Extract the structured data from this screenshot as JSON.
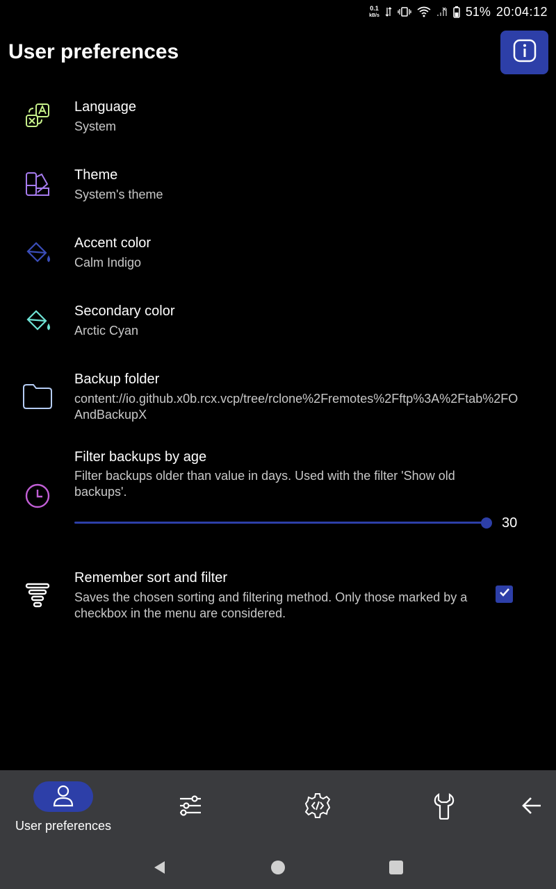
{
  "status_bar": {
    "net_speed_value": "0.1",
    "net_speed_unit": "kB/s",
    "battery_percent": "51%",
    "time": "20:04:12"
  },
  "header": {
    "title": "User preferences",
    "info_icon": "info-icon"
  },
  "preferences": [
    {
      "key": "language",
      "title": "Language",
      "summary": "System",
      "icon": "language-icon",
      "icon_color": "#c6f08a"
    },
    {
      "key": "theme",
      "title": "Theme",
      "summary": "System's theme",
      "icon": "theme-icon",
      "icon_color": "#a77cf0"
    },
    {
      "key": "accent",
      "title": "Accent color",
      "summary": "Calm Indigo",
      "icon": "paint-bucket-icon",
      "icon_color": "#3a4db8"
    },
    {
      "key": "secondary",
      "title": "Secondary color",
      "summary": "Arctic Cyan",
      "icon": "paint-bucket-icon",
      "icon_color": "#6fe3d5"
    },
    {
      "key": "backup",
      "title": "Backup folder",
      "summary": "content://io.github.x0b.rcx.vcp/tree/rclone%2Fremotes%2Fftp%3A%2Ftab%2FOAndBackupX",
      "icon": "folder-icon",
      "icon_color": "#b6cdf5"
    },
    {
      "key": "filter_age",
      "title": "Filter backups by age",
      "summary": "Filter backups older than value in days. Used with the filter 'Show old backups'.",
      "icon": "clock-icon",
      "icon_color": "#c25fd6",
      "value": "30",
      "slider_fraction": 1.0
    },
    {
      "key": "remember_sort",
      "title": "Remember sort and filter",
      "summary": "Saves the chosen sorting and filtering method. Only those marked by a checkbox in the menu are considered.",
      "icon": "filter-icon",
      "icon_color": "#ffffff",
      "checked": true
    }
  ],
  "bottom_nav": {
    "items": [
      {
        "label": "User preferences",
        "icon": "person-icon",
        "selected": true
      },
      {
        "label": "",
        "icon": "sliders-icon"
      },
      {
        "label": "",
        "icon": "gear-code-icon"
      },
      {
        "label": "",
        "icon": "wrench-icon"
      },
      {
        "label": "",
        "icon": "arrow-back-icon"
      }
    ]
  },
  "colors": {
    "accent": "#2d3fa8",
    "background": "#000000",
    "nav_background": "#3a3b3e",
    "summary_text": "#c8c8c8"
  }
}
